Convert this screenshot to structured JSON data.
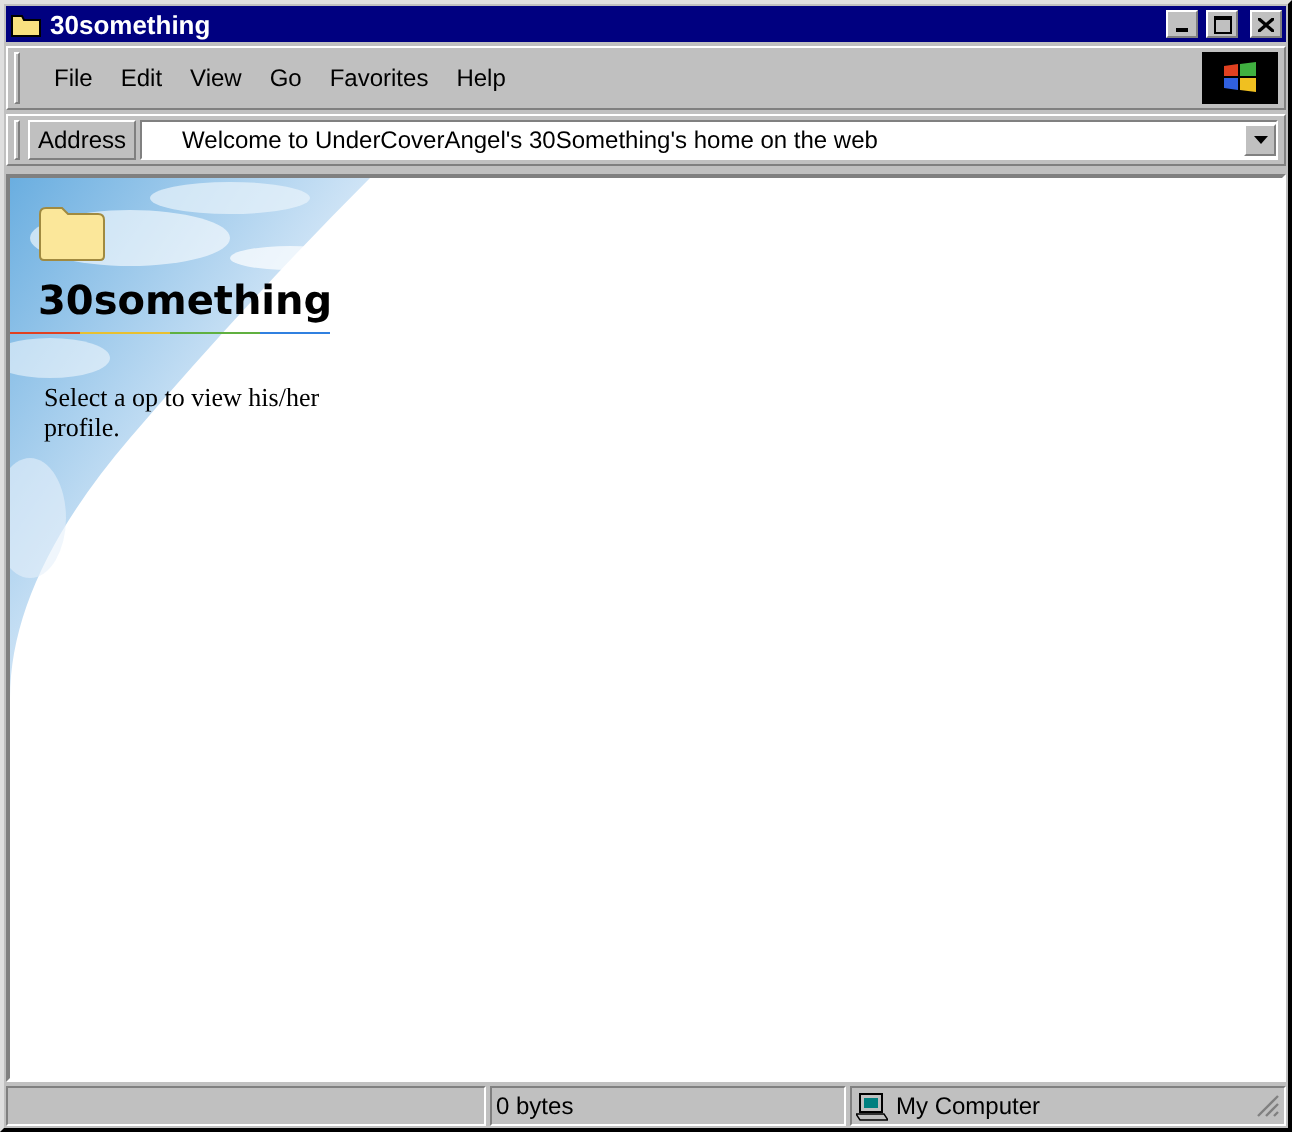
{
  "window": {
    "title": "30something"
  },
  "menu": [
    "File",
    "Edit",
    "View",
    "Go",
    "Favorites",
    "Help"
  ],
  "address": {
    "label": "Address",
    "value": "Welcome to UnderCoverAngel's 30Something's home on the web"
  },
  "page": {
    "heading": "30something",
    "text": "Select a op to view his/her profile."
  },
  "status_bar": {
    "size": "0 bytes",
    "zone": "My Computer"
  }
}
